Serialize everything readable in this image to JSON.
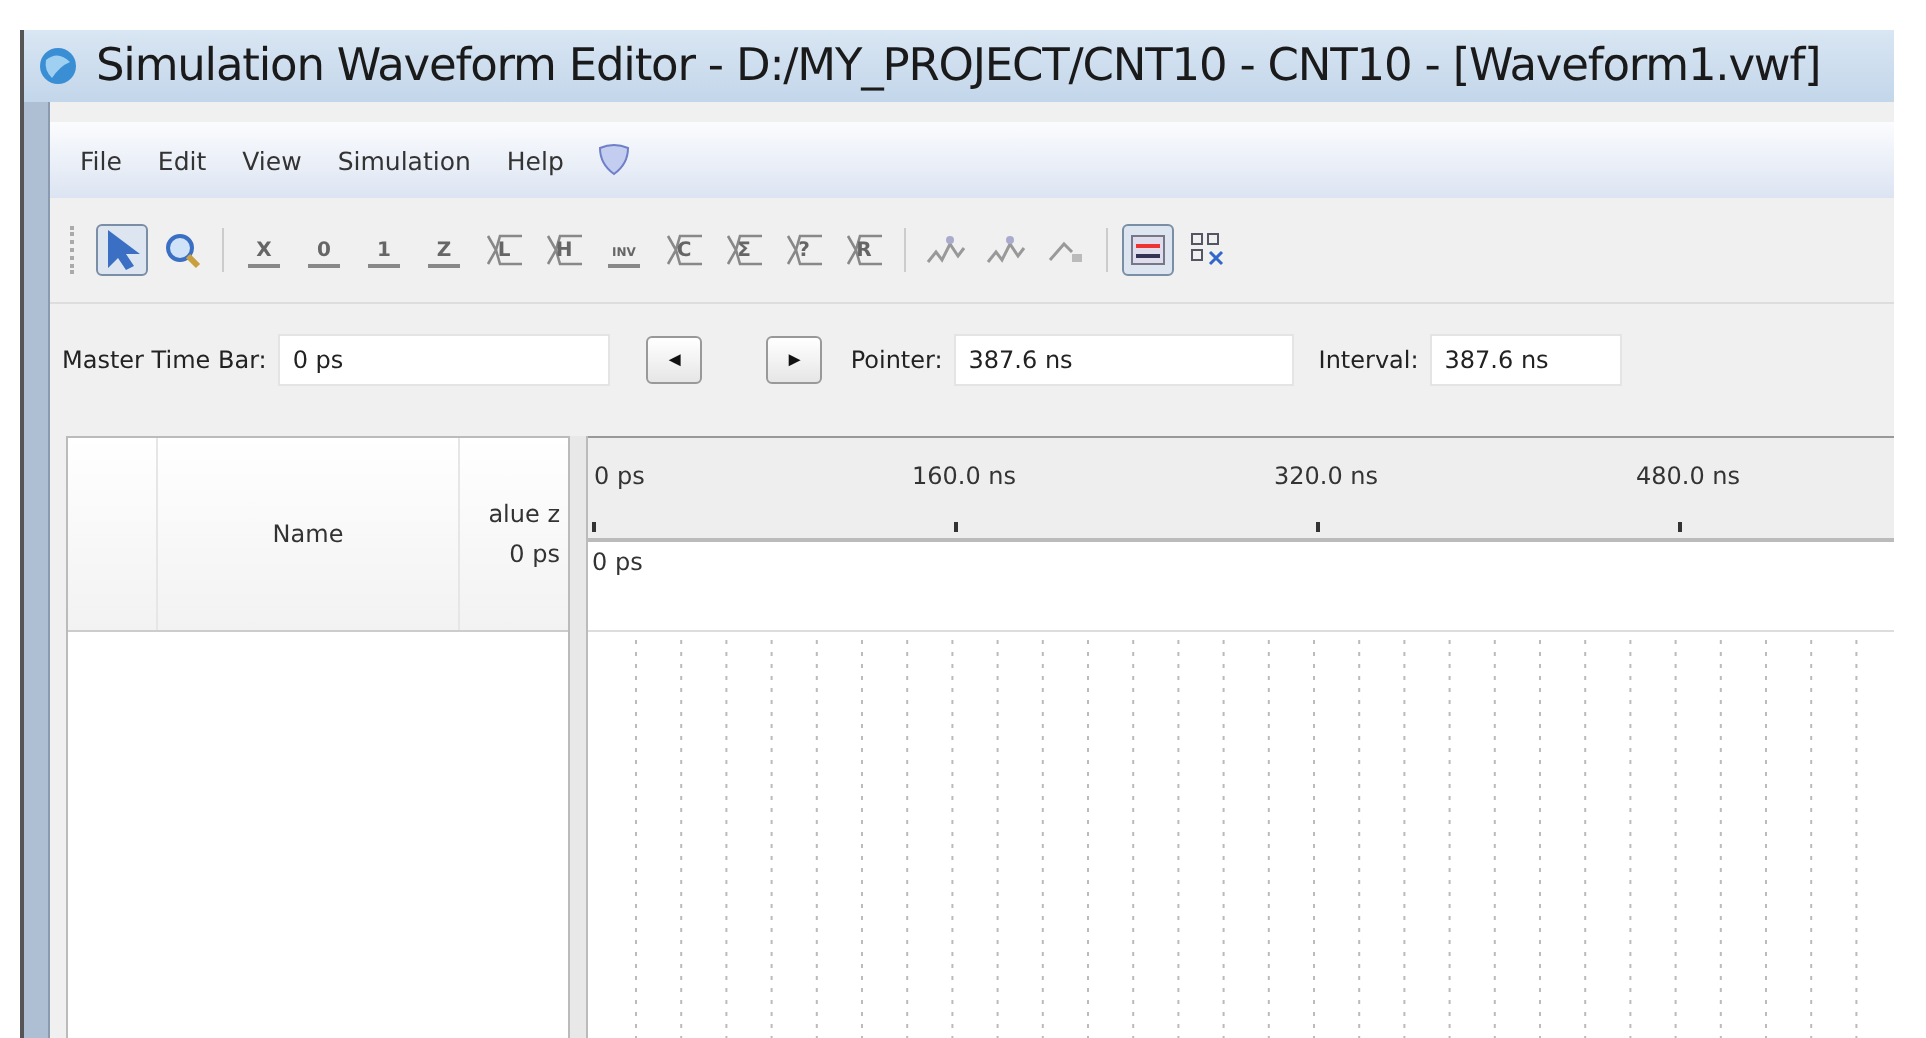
{
  "window": {
    "title": "Simulation Waveform Editor - D:/MY_PROJECT/CNT10 - CNT10 - [Waveform1.vwf]"
  },
  "menu": [
    "File",
    "Edit",
    "View",
    "Simulation",
    "Help"
  ],
  "toolbar": [
    {
      "kind": "pointer",
      "selected": true
    },
    {
      "kind": "zoom",
      "selected": false
    },
    {
      "kind": "sep"
    },
    {
      "kind": "value",
      "glyph": "X",
      "selected": false
    },
    {
      "kind": "value",
      "glyph": "0",
      "selected": false
    },
    {
      "kind": "value",
      "glyph": "1",
      "selected": false
    },
    {
      "kind": "value",
      "glyph": "Z",
      "selected": false
    },
    {
      "kind": "bus",
      "glyph": "L",
      "selected": false
    },
    {
      "kind": "bus",
      "glyph": "H",
      "selected": false
    },
    {
      "kind": "value",
      "glyph": "INV",
      "selected": false
    },
    {
      "kind": "bus",
      "glyph": "C",
      "selected": false
    },
    {
      "kind": "bus",
      "glyph": "Σ",
      "selected": false
    },
    {
      "kind": "bus",
      "glyph": "?",
      "selected": false
    },
    {
      "kind": "bus",
      "glyph": "R",
      "selected": false
    },
    {
      "kind": "sep"
    },
    {
      "kind": "wave",
      "selected": false
    },
    {
      "kind": "wave",
      "selected": false
    },
    {
      "kind": "snap",
      "selected": false
    },
    {
      "kind": "sep"
    },
    {
      "kind": "grid",
      "selected": true
    },
    {
      "kind": "tree",
      "selected": false
    }
  ],
  "time_bar": {
    "label": "Master Time Bar:",
    "value": "0 ps",
    "prev": "◄",
    "next": "►",
    "pointer_label": "Pointer:",
    "pointer_value": "387.6 ns",
    "interval_label": "Interval:",
    "interval_value": "387.6 ns"
  },
  "signals": {
    "columns": [
      "Name",
      "alue z\n0 ps"
    ]
  },
  "waveform": {
    "ruler": [
      "0 ps",
      "160.0 ns",
      "320.0 ns",
      "480.0 ns"
    ],
    "cursor": "0 ps"
  }
}
